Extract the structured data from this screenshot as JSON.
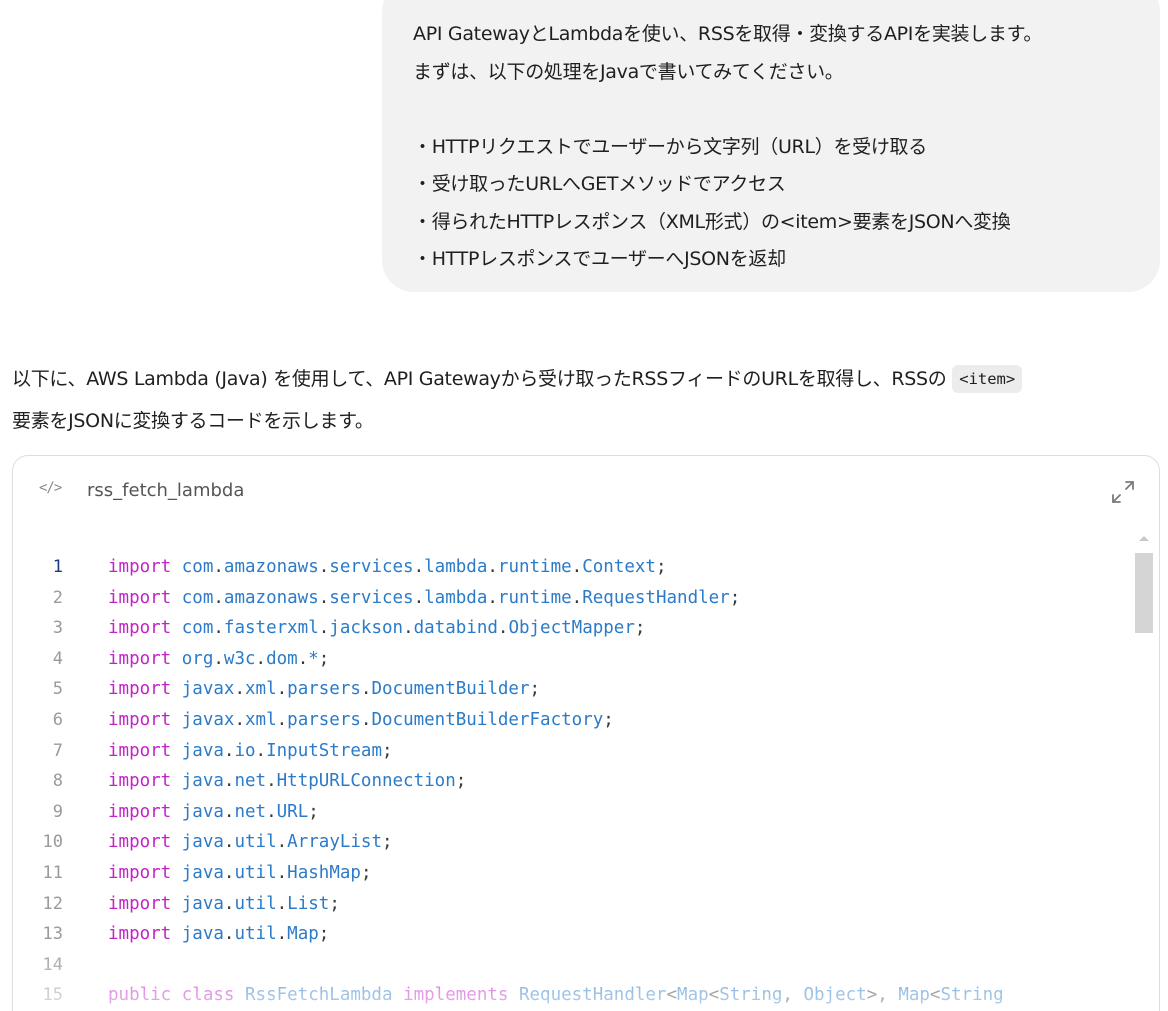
{
  "user_message": {
    "lines": [
      "API GatewayとLambdaを使い、RSSを取得・変換するAPIを実装します。",
      "まずは、以下の処理をJavaで書いてみてください。",
      "",
      "・HTTPリクエストでユーザーから文字列（URL）を受け取る",
      "・受け取ったURLへGETメソッドでアクセス",
      "・得られたHTTPレスポンス（XML形式）の<item>要素をJSONへ変換",
      "・HTTPレスポンスでユーザーへJSONを返却"
    ]
  },
  "assistant_message": {
    "line1_before": "以下に、AWS Lambda (Java) を使用して、API Gatewayから受け取ったRSSフィードのURLを取得し、RSSの ",
    "inline_code": "<item>",
    "line2": "要素をJSONに変換するコードを示します。"
  },
  "code_block": {
    "icon": "</>",
    "title": "rss_fetch_lambda",
    "active_line": 1,
    "lines": [
      {
        "n": "1",
        "tokens": [
          [
            "kw",
            "import"
          ],
          [
            "punc",
            " "
          ],
          [
            "pkg",
            "com"
          ],
          [
            "punc",
            "."
          ],
          [
            "pkg",
            "amazonaws"
          ],
          [
            "punc",
            "."
          ],
          [
            "pkg",
            "services"
          ],
          [
            "punc",
            "."
          ],
          [
            "pkg",
            "lambda"
          ],
          [
            "punc",
            "."
          ],
          [
            "pkg",
            "runtime"
          ],
          [
            "punc",
            "."
          ],
          [
            "cls",
            "Context"
          ],
          [
            "punc",
            ";"
          ]
        ]
      },
      {
        "n": "2",
        "tokens": [
          [
            "kw",
            "import"
          ],
          [
            "punc",
            " "
          ],
          [
            "pkg",
            "com"
          ],
          [
            "punc",
            "."
          ],
          [
            "pkg",
            "amazonaws"
          ],
          [
            "punc",
            "."
          ],
          [
            "pkg",
            "services"
          ],
          [
            "punc",
            "."
          ],
          [
            "pkg",
            "lambda"
          ],
          [
            "punc",
            "."
          ],
          [
            "pkg",
            "runtime"
          ],
          [
            "punc",
            "."
          ],
          [
            "cls",
            "RequestHandler"
          ],
          [
            "punc",
            ";"
          ]
        ]
      },
      {
        "n": "3",
        "tokens": [
          [
            "kw",
            "import"
          ],
          [
            "punc",
            " "
          ],
          [
            "pkg",
            "com"
          ],
          [
            "punc",
            "."
          ],
          [
            "pkg",
            "fasterxml"
          ],
          [
            "punc",
            "."
          ],
          [
            "pkg",
            "jackson"
          ],
          [
            "punc",
            "."
          ],
          [
            "pkg",
            "databind"
          ],
          [
            "punc",
            "."
          ],
          [
            "cls",
            "ObjectMapper"
          ],
          [
            "punc",
            ";"
          ]
        ]
      },
      {
        "n": "4",
        "tokens": [
          [
            "kw",
            "import"
          ],
          [
            "punc",
            " "
          ],
          [
            "pkg",
            "org"
          ],
          [
            "punc",
            "."
          ],
          [
            "pkg",
            "w3c"
          ],
          [
            "punc",
            "."
          ],
          [
            "pkg",
            "dom"
          ],
          [
            "punc",
            "."
          ],
          [
            "cls",
            "*"
          ],
          [
            "punc",
            ";"
          ]
        ]
      },
      {
        "n": "5",
        "tokens": [
          [
            "kw",
            "import"
          ],
          [
            "punc",
            " "
          ],
          [
            "pkg",
            "javax"
          ],
          [
            "punc",
            "."
          ],
          [
            "pkg",
            "xml"
          ],
          [
            "punc",
            "."
          ],
          [
            "pkg",
            "parsers"
          ],
          [
            "punc",
            "."
          ],
          [
            "cls",
            "DocumentBuilder"
          ],
          [
            "punc",
            ";"
          ]
        ]
      },
      {
        "n": "6",
        "tokens": [
          [
            "kw",
            "import"
          ],
          [
            "punc",
            " "
          ],
          [
            "pkg",
            "javax"
          ],
          [
            "punc",
            "."
          ],
          [
            "pkg",
            "xml"
          ],
          [
            "punc",
            "."
          ],
          [
            "pkg",
            "parsers"
          ],
          [
            "punc",
            "."
          ],
          [
            "cls",
            "DocumentBuilderFactory"
          ],
          [
            "punc",
            ";"
          ]
        ]
      },
      {
        "n": "7",
        "tokens": [
          [
            "kw",
            "import"
          ],
          [
            "punc",
            " "
          ],
          [
            "pkg",
            "java"
          ],
          [
            "punc",
            "."
          ],
          [
            "pkg",
            "io"
          ],
          [
            "punc",
            "."
          ],
          [
            "cls",
            "InputStream"
          ],
          [
            "punc",
            ";"
          ]
        ]
      },
      {
        "n": "8",
        "tokens": [
          [
            "kw",
            "import"
          ],
          [
            "punc",
            " "
          ],
          [
            "pkg",
            "java"
          ],
          [
            "punc",
            "."
          ],
          [
            "pkg",
            "net"
          ],
          [
            "punc",
            "."
          ],
          [
            "cls",
            "HttpURLConnection"
          ],
          [
            "punc",
            ";"
          ]
        ]
      },
      {
        "n": "9",
        "tokens": [
          [
            "kw",
            "import"
          ],
          [
            "punc",
            " "
          ],
          [
            "pkg",
            "java"
          ],
          [
            "punc",
            "."
          ],
          [
            "pkg",
            "net"
          ],
          [
            "punc",
            "."
          ],
          [
            "cls",
            "URL"
          ],
          [
            "punc",
            ";"
          ]
        ]
      },
      {
        "n": "10",
        "tokens": [
          [
            "kw",
            "import"
          ],
          [
            "punc",
            " "
          ],
          [
            "pkg",
            "java"
          ],
          [
            "punc",
            "."
          ],
          [
            "pkg",
            "util"
          ],
          [
            "punc",
            "."
          ],
          [
            "cls",
            "ArrayList"
          ],
          [
            "punc",
            ";"
          ]
        ]
      },
      {
        "n": "11",
        "tokens": [
          [
            "kw",
            "import"
          ],
          [
            "punc",
            " "
          ],
          [
            "pkg",
            "java"
          ],
          [
            "punc",
            "."
          ],
          [
            "pkg",
            "util"
          ],
          [
            "punc",
            "."
          ],
          [
            "cls",
            "HashMap"
          ],
          [
            "punc",
            ";"
          ]
        ]
      },
      {
        "n": "12",
        "tokens": [
          [
            "kw",
            "import"
          ],
          [
            "punc",
            " "
          ],
          [
            "pkg",
            "java"
          ],
          [
            "punc",
            "."
          ],
          [
            "pkg",
            "util"
          ],
          [
            "punc",
            "."
          ],
          [
            "cls",
            "List"
          ],
          [
            "punc",
            ";"
          ]
        ]
      },
      {
        "n": "13",
        "tokens": [
          [
            "kw",
            "import"
          ],
          [
            "punc",
            " "
          ],
          [
            "pkg",
            "java"
          ],
          [
            "punc",
            "."
          ],
          [
            "pkg",
            "util"
          ],
          [
            "punc",
            "."
          ],
          [
            "cls",
            "Map"
          ],
          [
            "punc",
            ";"
          ]
        ]
      },
      {
        "n": "14",
        "tokens": []
      },
      {
        "n": "15",
        "tokens": [
          [
            "kw",
            "public"
          ],
          [
            "punc",
            " "
          ],
          [
            "kw",
            "class"
          ],
          [
            "punc",
            " "
          ],
          [
            "cls",
            "RssFetchLambda"
          ],
          [
            "punc",
            " "
          ],
          [
            "kw",
            "implements"
          ],
          [
            "punc",
            " "
          ],
          [
            "cls",
            "RequestHandler"
          ],
          [
            "punc",
            "<"
          ],
          [
            "cls",
            "Map"
          ],
          [
            "punc",
            "<"
          ],
          [
            "cls",
            "String"
          ],
          [
            "punc",
            ", "
          ],
          [
            "cls",
            "Object"
          ],
          [
            "punc",
            ">, "
          ],
          [
            "cls",
            "Map"
          ],
          [
            "punc",
            "<"
          ],
          [
            "cls",
            "String"
          ]
        ]
      }
    ]
  },
  "colors": {
    "keyword": "#c222c7",
    "identifier": "#2b7bc9",
    "bubble_bg": "#f2f2f2"
  },
  "icons": {
    "code": "code-icon",
    "expand": "expand-icon"
  }
}
